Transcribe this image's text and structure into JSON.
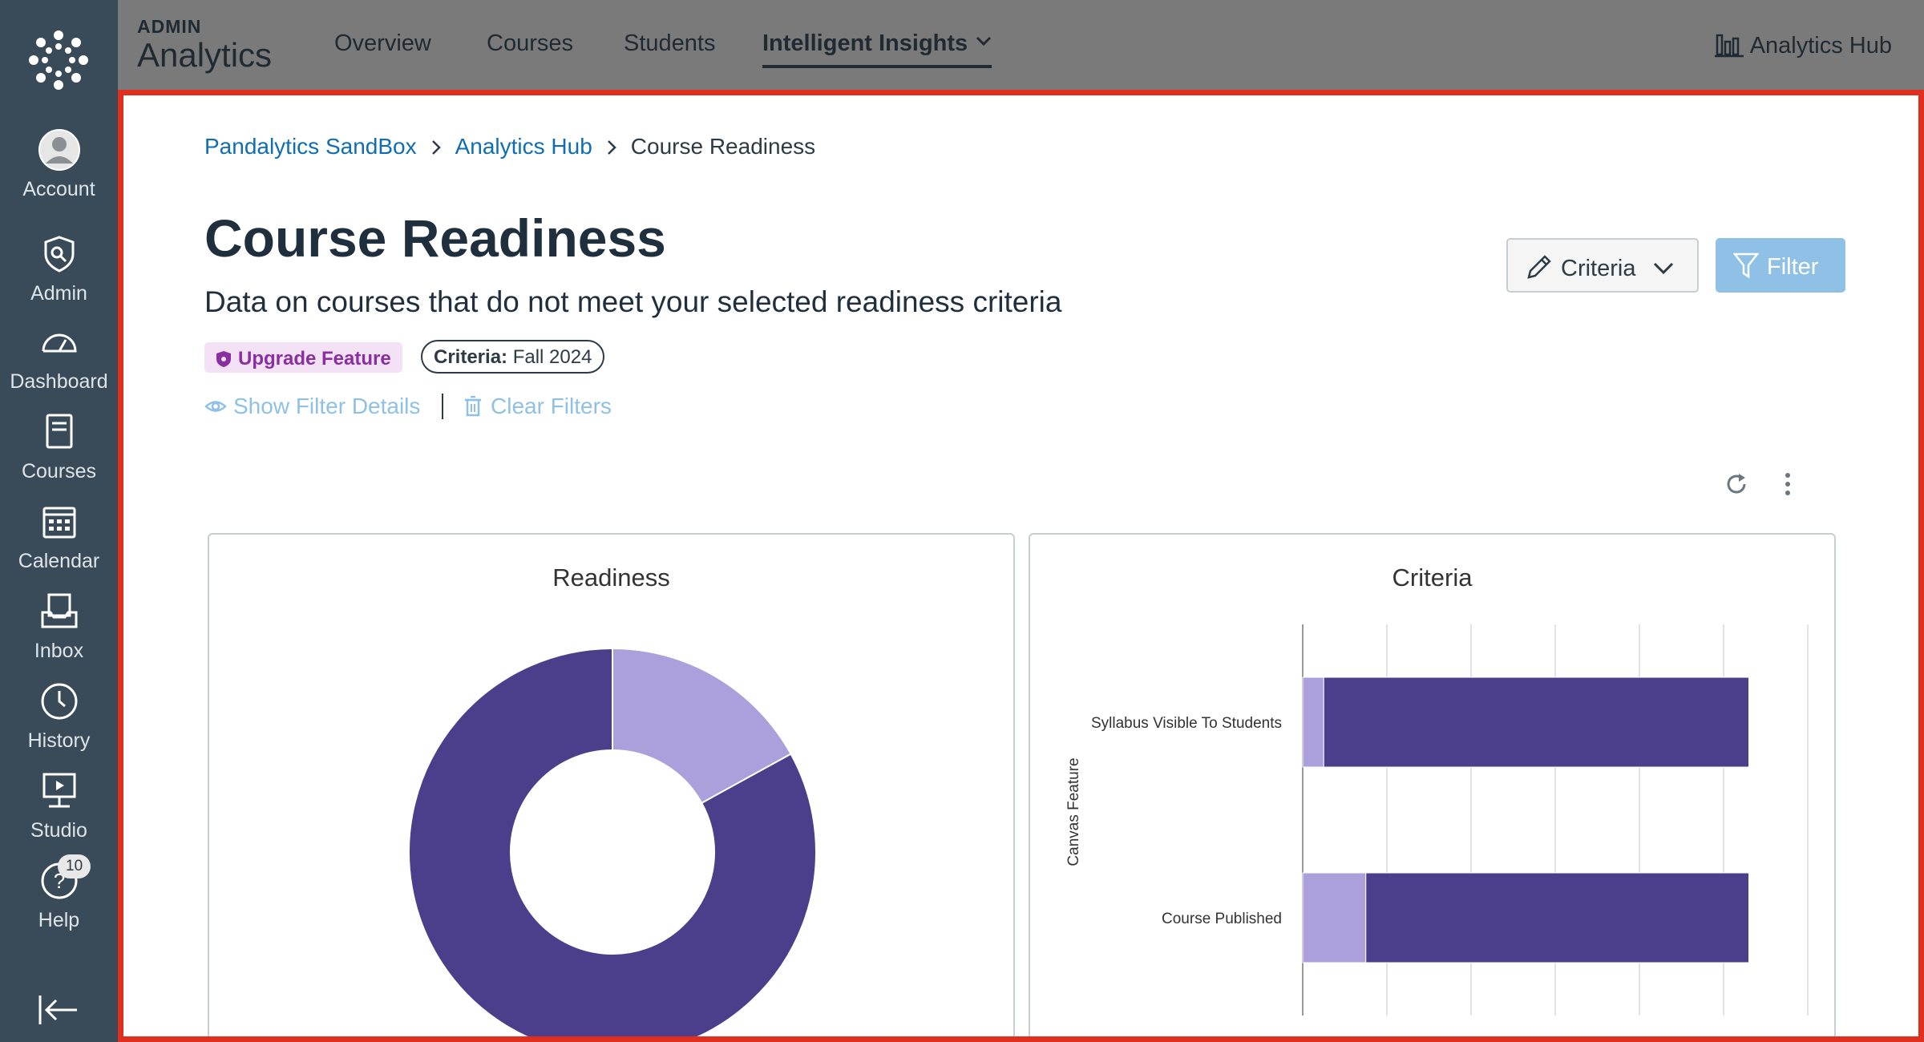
{
  "global_nav": {
    "items": [
      {
        "label": "Account",
        "icon": "account-icon"
      },
      {
        "label": "Admin",
        "icon": "admin-icon"
      },
      {
        "label": "Dashboard",
        "icon": "dashboard-icon"
      },
      {
        "label": "Courses",
        "icon": "courses-icon"
      },
      {
        "label": "Calendar",
        "icon": "calendar-icon"
      },
      {
        "label": "Inbox",
        "icon": "inbox-icon"
      },
      {
        "label": "History",
        "icon": "history-icon"
      },
      {
        "label": "Studio",
        "icon": "studio-icon"
      },
      {
        "label": "Help",
        "icon": "help-icon",
        "badge": "10"
      }
    ]
  },
  "topbar": {
    "brand_small": "ADMIN",
    "brand_big": "Analytics",
    "tabs": [
      {
        "label": "Overview"
      },
      {
        "label": "Courses"
      },
      {
        "label": "Students"
      },
      {
        "label": "Intelligent Insights",
        "active": true
      }
    ],
    "hub_link": "Analytics Hub"
  },
  "breadcrumb": {
    "items": [
      "Pandalytics SandBox",
      "Analytics Hub"
    ],
    "current": "Course Readiness"
  },
  "page": {
    "title": "Course Readiness",
    "subtitle": "Data on courses that do not meet your selected readiness criteria",
    "upgrade_badge": "Upgrade Feature",
    "criteria_pill_label": "Criteria:",
    "criteria_pill_value": "Fall 2024",
    "show_filter_details": "Show Filter Details",
    "clear_filters": "Clear Filters",
    "criteria_button": "Criteria",
    "filter_button": "Filter"
  },
  "colors": {
    "dark_purple": "#4b3f8c",
    "light_purple": "#ab9fdc",
    "link_blue": "#0f6eb1",
    "nav_bg": "#394b58"
  },
  "chart_data": [
    {
      "type": "pie",
      "title": "Readiness",
      "donut": true,
      "slices": [
        {
          "value": 17,
          "color": "#ab9fdc"
        },
        {
          "value": 83,
          "color": "#4b3f8c"
        }
      ]
    },
    {
      "type": "bar",
      "orientation": "horizontal",
      "stacked": true,
      "title": "Criteria",
      "ylabel": "Canvas Feature",
      "xlim": [
        0,
        120
      ],
      "xticks": [
        "0",
        "20",
        "40",
        "60",
        "80",
        "100",
        "120"
      ],
      "grid": true,
      "categories": [
        "Syllabus Visible To Students",
        "Course Published"
      ],
      "series": [
        {
          "values": [
            5,
            15
          ],
          "color": "#ab9fdc"
        },
        {
          "values": [
            101,
            91
          ],
          "color": "#4b3f8c"
        }
      ]
    }
  ]
}
